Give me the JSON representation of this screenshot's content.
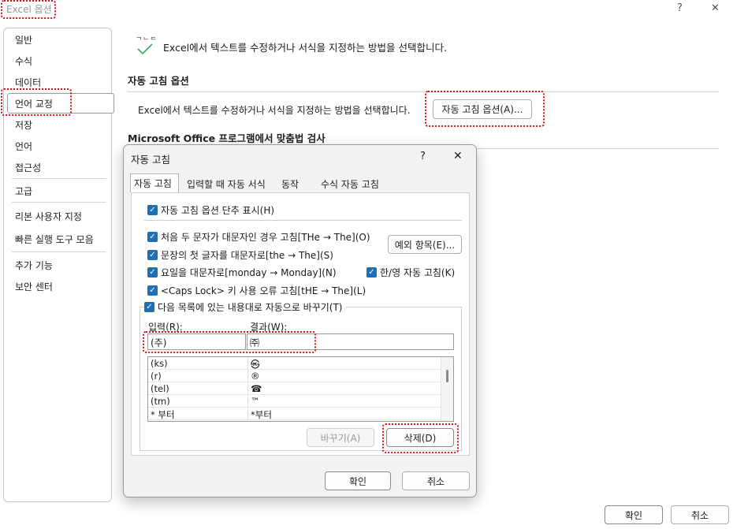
{
  "window": {
    "title": "Excel 옵션",
    "help_symbol": "?",
    "close_symbol": "✕"
  },
  "sidebar": {
    "items": [
      {
        "label": "일반"
      },
      {
        "label": "수식"
      },
      {
        "label": "데이터"
      },
      {
        "label": "언어 교정"
      },
      {
        "label": "저장"
      },
      {
        "label": "언어"
      },
      {
        "label": "접근성"
      },
      {
        "label": "고급"
      },
      {
        "label": "리본 사용자 지정"
      },
      {
        "label": "빠른 실행 도구 모음"
      },
      {
        "label": "추가 기능"
      },
      {
        "label": "보안 센터"
      }
    ],
    "selected_index": 3
  },
  "main": {
    "header_icon_text": "ᄀᄂᄃ",
    "header_text": "Excel에서 텍스트를 수정하거나 서식을 지정하는 방법을 선택합니다.",
    "autocorrect_section": {
      "title": "자동 고침 옵션",
      "desc": "Excel에서 텍스트를 수정하거나 서식을 지정하는 방법을 선택합니다.",
      "button_label": "자동 고침 옵션(A)..."
    },
    "spelling_section": {
      "title": "Microsoft Office 프로그램에서 맞춤법 검사"
    }
  },
  "dialog": {
    "title": "자동 고침",
    "help_symbol": "?",
    "close_symbol": "✕",
    "tabs": [
      {
        "label": "자동 고침",
        "active": true
      },
      {
        "label": "입력할 때 자동 서식",
        "active": false
      },
      {
        "label": "동작",
        "active": false
      },
      {
        "label": "수식 자동 고침",
        "active": false
      }
    ],
    "checkboxes": {
      "show_buttons": "자동 고침 옵션 단추 표시(H)",
      "two_initial_caps": "처음 두 문자가 대문자인 경우 고침[THe → The](O)",
      "capitalize_sentence": "문장의 첫 글자를 대문자로[the → The](S)",
      "capitalize_days": "요일을 대문자로[monday → Monday](N)",
      "caps_lock": "<Caps Lock> 키 사용 오류 고침[tHE → The](L)",
      "replace_text": "다음 목록에 있는 내용대로 자동으로 바꾸기(T)",
      "korean_english": "한/영 자동 고침(K)"
    },
    "exceptions_button": "예외 항목(E)...",
    "replace_label": "입력(R):",
    "with_label": "결과(W):",
    "replace_value": "(주)",
    "with_value": "㈜",
    "list_rows": [
      {
        "input": "(ks)",
        "result": "㉿"
      },
      {
        "input": "(r)",
        "result": "®"
      },
      {
        "input": "(tel)",
        "result": "☎"
      },
      {
        "input": "(tm)",
        "result": "™"
      },
      {
        "input": "* 부터",
        "result": "*부터"
      }
    ],
    "replace_button": "바꾸기(A)",
    "delete_button": "삭제(D)",
    "ok_button": "확인",
    "cancel_button": "취소"
  },
  "footer": {
    "ok_button": "확인",
    "cancel_button": "취소"
  },
  "colors": {
    "highlight": "#d8141b",
    "checkbox": "#1f6fb6",
    "check_green": "#3aa76d"
  }
}
